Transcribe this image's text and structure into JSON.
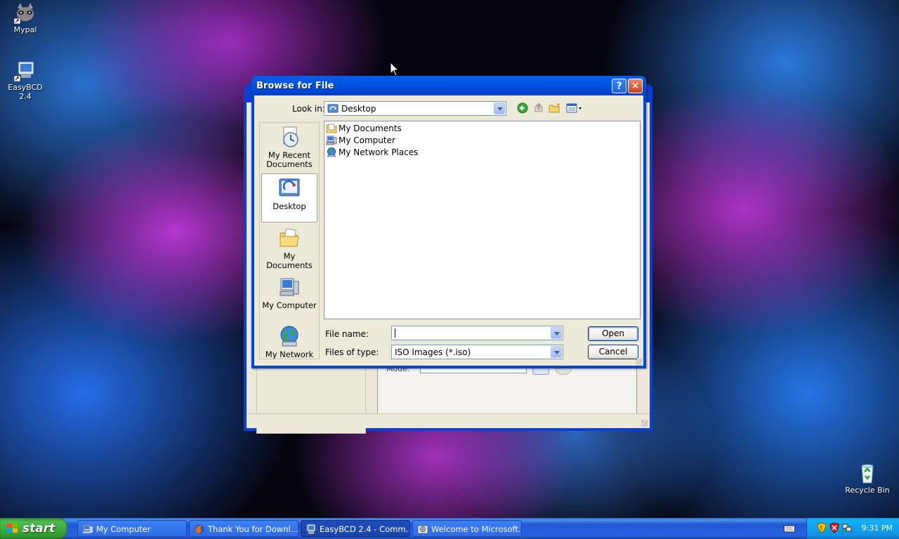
{
  "desktop": {
    "icons": [
      {
        "label": "Mypal"
      },
      {
        "label": "EasyBCD 2.4"
      },
      {
        "label": "Recycle Bin"
      }
    ]
  },
  "background_window": {
    "mode_label": "Mode:"
  },
  "dialog": {
    "title": "Browse for File",
    "help_label": "?",
    "close_label": "✕",
    "look_in_label": "Look in:",
    "look_in_value": "Desktop",
    "places": [
      {
        "label": "My Recent Documents",
        "icon": "recent-documents-icon"
      },
      {
        "label": "Desktop",
        "icon": "desktop-icon",
        "selected": true
      },
      {
        "label": "My Documents",
        "icon": "my-documents-icon"
      },
      {
        "label": "My Computer",
        "icon": "my-computer-icon"
      },
      {
        "label": "My Network",
        "icon": "my-network-icon"
      }
    ],
    "files": [
      {
        "name": "My Documents",
        "icon": "folder-documents-icon"
      },
      {
        "name": "My Computer",
        "icon": "computer-icon"
      },
      {
        "name": "My Network Places",
        "icon": "network-places-icon"
      }
    ],
    "file_name_label": "File name:",
    "file_name_value": "",
    "files_of_type_label": "Files of type:",
    "files_of_type_value": "ISO Images (*.iso)",
    "open_label": "Open",
    "cancel_label": "Cancel"
  },
  "taskbar": {
    "start_label": "start",
    "tasks": [
      {
        "label": "My Computer",
        "icon": "my-computer-icon",
        "active": false
      },
      {
        "label": "Thank You for Downl...",
        "icon": "firefox-icon",
        "active": false
      },
      {
        "label": "EasyBCD 2.4 - Comm...",
        "icon": "easybcd-icon",
        "active": true
      },
      {
        "label": "Welcome to Microsoft...",
        "icon": "installer-icon",
        "active": false
      }
    ],
    "clock": "9:31 PM"
  }
}
